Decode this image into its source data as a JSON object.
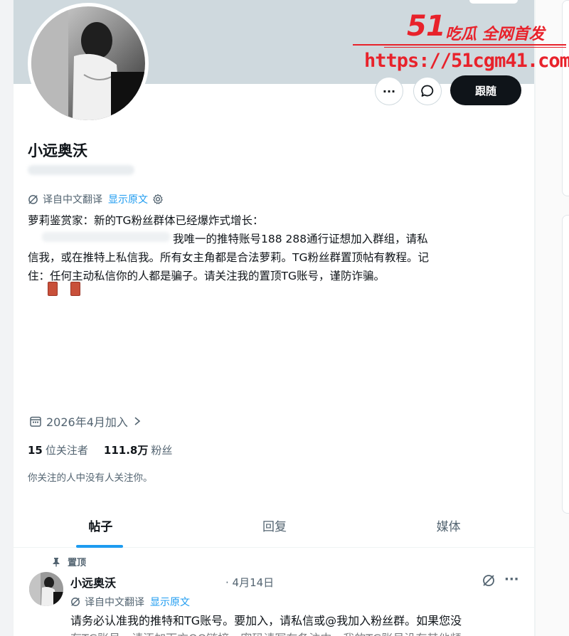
{
  "profile": {
    "display_name": "小远奥沃",
    "translate_label": "译自中文翻译",
    "show_original": "显示原文",
    "bio": {
      "line1": "萝莉鉴赏家：新的TG粉丝群体已经爆炸式增长：",
      "line2": "我唯一的推特账号188 288通行证想加入群组，请私",
      "line3": "信我，或在推特上私信我。所有女主角都是合法萝莉。TG粉丝群置顶帖有教程。记",
      "line4": "住：任何主动私信你的人都是骗子。请关注我的置顶TG账号，谨防诈骗。"
    },
    "joined": "2026年4月加入",
    "following_count": "15",
    "following_label": "位关注者",
    "followers_count": "111.8万",
    "followers_label": "粉丝",
    "followed_by": "你关注的人中没有人关注你。"
  },
  "actions": {
    "more": "···",
    "follow": "跟随"
  },
  "tabs": [
    {
      "label": "帖子"
    },
    {
      "label": "回复"
    },
    {
      "label": "媒体"
    }
  ],
  "post": {
    "pinned_label": "置顶",
    "author": "小远奥沃",
    "date": "· 4月14日",
    "more": "···",
    "translate_label": "译自中文翻译",
    "show_original": "显示原文",
    "text": "请务必认准我的推特和TG账号。要加入，请私信或@我加入粉丝群。如果您没",
    "text_cut": "有TG账号，请添加下方QQ链接，密码请写在备注中。我的TG账号没有其他频"
  },
  "watermark": {
    "number": "51",
    "tagline": "吃瓜 全网首发",
    "url": "https://51cgm41.com"
  },
  "colors": {
    "accent": "#1d9bf0",
    "watermark": "#e8222b",
    "banner": "#cfd9de"
  }
}
